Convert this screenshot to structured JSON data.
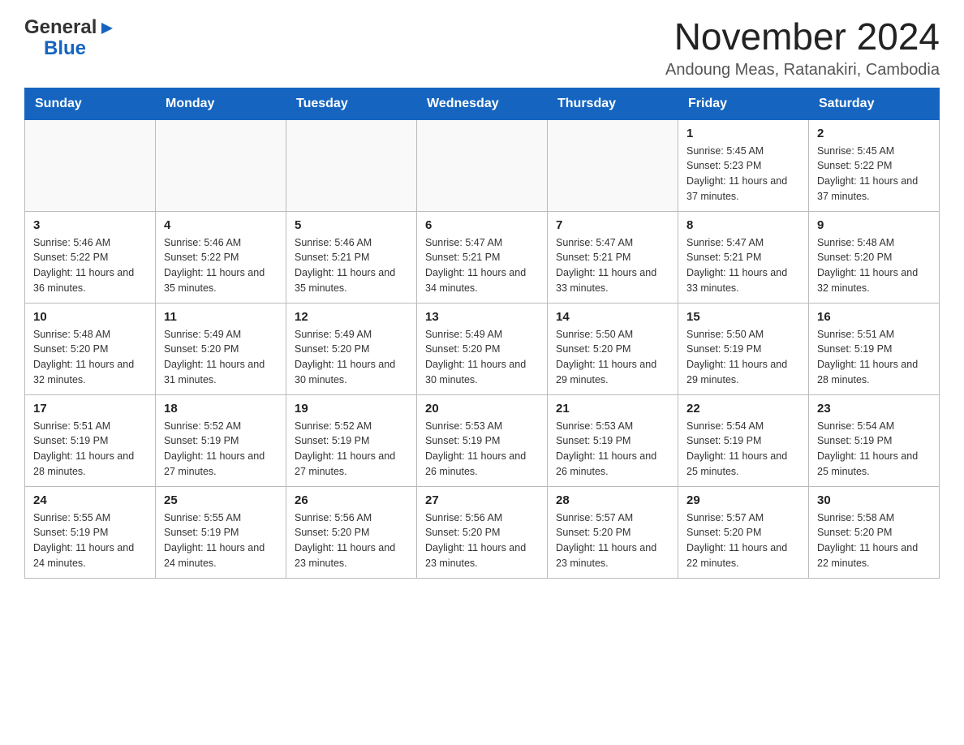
{
  "logo": {
    "text_general": "General",
    "text_blue": "Blue"
  },
  "header": {
    "month_title": "November 2024",
    "location": "Andoung Meas, Ratanakiri, Cambodia"
  },
  "weekdays": [
    "Sunday",
    "Monday",
    "Tuesday",
    "Wednesday",
    "Thursday",
    "Friday",
    "Saturday"
  ],
  "weeks": [
    [
      {
        "day": "",
        "info": ""
      },
      {
        "day": "",
        "info": ""
      },
      {
        "day": "",
        "info": ""
      },
      {
        "day": "",
        "info": ""
      },
      {
        "day": "",
        "info": ""
      },
      {
        "day": "1",
        "info": "Sunrise: 5:45 AM\nSunset: 5:23 PM\nDaylight: 11 hours and 37 minutes."
      },
      {
        "day": "2",
        "info": "Sunrise: 5:45 AM\nSunset: 5:22 PM\nDaylight: 11 hours and 37 minutes."
      }
    ],
    [
      {
        "day": "3",
        "info": "Sunrise: 5:46 AM\nSunset: 5:22 PM\nDaylight: 11 hours and 36 minutes."
      },
      {
        "day": "4",
        "info": "Sunrise: 5:46 AM\nSunset: 5:22 PM\nDaylight: 11 hours and 35 minutes."
      },
      {
        "day": "5",
        "info": "Sunrise: 5:46 AM\nSunset: 5:21 PM\nDaylight: 11 hours and 35 minutes."
      },
      {
        "day": "6",
        "info": "Sunrise: 5:47 AM\nSunset: 5:21 PM\nDaylight: 11 hours and 34 minutes."
      },
      {
        "day": "7",
        "info": "Sunrise: 5:47 AM\nSunset: 5:21 PM\nDaylight: 11 hours and 33 minutes."
      },
      {
        "day": "8",
        "info": "Sunrise: 5:47 AM\nSunset: 5:21 PM\nDaylight: 11 hours and 33 minutes."
      },
      {
        "day": "9",
        "info": "Sunrise: 5:48 AM\nSunset: 5:20 PM\nDaylight: 11 hours and 32 minutes."
      }
    ],
    [
      {
        "day": "10",
        "info": "Sunrise: 5:48 AM\nSunset: 5:20 PM\nDaylight: 11 hours and 32 minutes."
      },
      {
        "day": "11",
        "info": "Sunrise: 5:49 AM\nSunset: 5:20 PM\nDaylight: 11 hours and 31 minutes."
      },
      {
        "day": "12",
        "info": "Sunrise: 5:49 AM\nSunset: 5:20 PM\nDaylight: 11 hours and 30 minutes."
      },
      {
        "day": "13",
        "info": "Sunrise: 5:49 AM\nSunset: 5:20 PM\nDaylight: 11 hours and 30 minutes."
      },
      {
        "day": "14",
        "info": "Sunrise: 5:50 AM\nSunset: 5:20 PM\nDaylight: 11 hours and 29 minutes."
      },
      {
        "day": "15",
        "info": "Sunrise: 5:50 AM\nSunset: 5:19 PM\nDaylight: 11 hours and 29 minutes."
      },
      {
        "day": "16",
        "info": "Sunrise: 5:51 AM\nSunset: 5:19 PM\nDaylight: 11 hours and 28 minutes."
      }
    ],
    [
      {
        "day": "17",
        "info": "Sunrise: 5:51 AM\nSunset: 5:19 PM\nDaylight: 11 hours and 28 minutes."
      },
      {
        "day": "18",
        "info": "Sunrise: 5:52 AM\nSunset: 5:19 PM\nDaylight: 11 hours and 27 minutes."
      },
      {
        "day": "19",
        "info": "Sunrise: 5:52 AM\nSunset: 5:19 PM\nDaylight: 11 hours and 27 minutes."
      },
      {
        "day": "20",
        "info": "Sunrise: 5:53 AM\nSunset: 5:19 PM\nDaylight: 11 hours and 26 minutes."
      },
      {
        "day": "21",
        "info": "Sunrise: 5:53 AM\nSunset: 5:19 PM\nDaylight: 11 hours and 26 minutes."
      },
      {
        "day": "22",
        "info": "Sunrise: 5:54 AM\nSunset: 5:19 PM\nDaylight: 11 hours and 25 minutes."
      },
      {
        "day": "23",
        "info": "Sunrise: 5:54 AM\nSunset: 5:19 PM\nDaylight: 11 hours and 25 minutes."
      }
    ],
    [
      {
        "day": "24",
        "info": "Sunrise: 5:55 AM\nSunset: 5:19 PM\nDaylight: 11 hours and 24 minutes."
      },
      {
        "day": "25",
        "info": "Sunrise: 5:55 AM\nSunset: 5:19 PM\nDaylight: 11 hours and 24 minutes."
      },
      {
        "day": "26",
        "info": "Sunrise: 5:56 AM\nSunset: 5:20 PM\nDaylight: 11 hours and 23 minutes."
      },
      {
        "day": "27",
        "info": "Sunrise: 5:56 AM\nSunset: 5:20 PM\nDaylight: 11 hours and 23 minutes."
      },
      {
        "day": "28",
        "info": "Sunrise: 5:57 AM\nSunset: 5:20 PM\nDaylight: 11 hours and 23 minutes."
      },
      {
        "day": "29",
        "info": "Sunrise: 5:57 AM\nSunset: 5:20 PM\nDaylight: 11 hours and 22 minutes."
      },
      {
        "day": "30",
        "info": "Sunrise: 5:58 AM\nSunset: 5:20 PM\nDaylight: 11 hours and 22 minutes."
      }
    ]
  ]
}
